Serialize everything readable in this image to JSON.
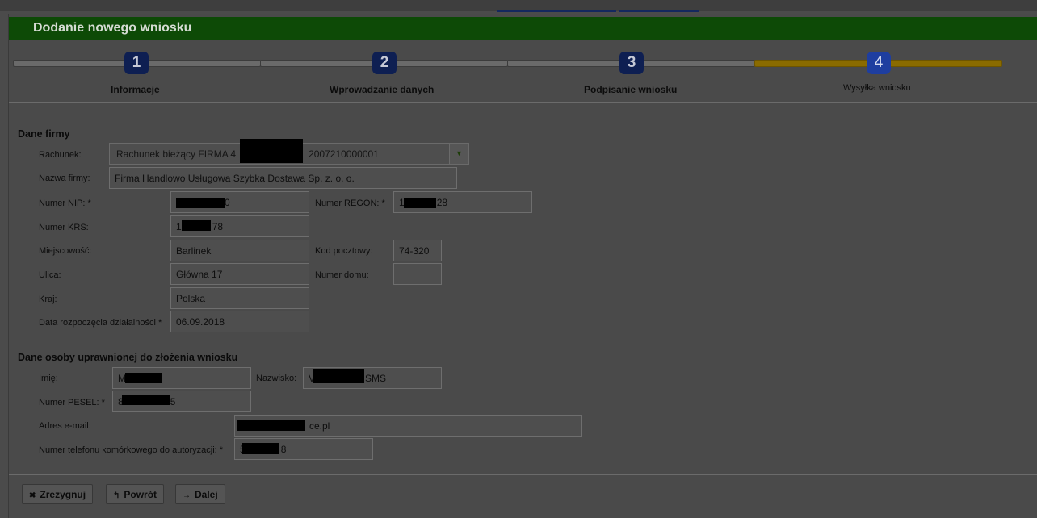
{
  "page": {
    "title": "Dodanie nowego wniosku"
  },
  "steps": [
    {
      "number": "1",
      "label": "Informacje"
    },
    {
      "number": "2",
      "label": "Wprowadzanie danych"
    },
    {
      "number": "3",
      "label": "Podpisanie wniosku"
    },
    {
      "number": "4",
      "label": "Wysyłka wniosku",
      "current": true
    }
  ],
  "company": {
    "section_title": "Dane firmy",
    "account_label": "Rachunek:",
    "account_value_prefix": "Rachunek bieżący FIRMA 4",
    "account_value_suffix": "2007210000001",
    "name_label": "Nazwa firmy:",
    "name_value": "Firma Handlowo Usługowa Szybka Dostawa Sp. z. o. o.",
    "nip_label": "Numer NIP: *",
    "nip_value": "0",
    "regon_label": "Numer REGON: *",
    "regon_value_prefix": "1",
    "regon_value_suffix": "28",
    "krs_label": "Numer KRS:",
    "krs_value_prefix": "1",
    "krs_value_suffix": "78",
    "city_label": "Miejscowość:",
    "city_value": "Barlinek",
    "postal_label": "Kod pocztowy:",
    "postal_value": "74-320",
    "street_label": "Ulica:",
    "street_value": "Główna 17",
    "house_label": "Numer domu:",
    "house_value": "",
    "country_label": "Kraj:",
    "country_value": "Polska",
    "start_label": "Data rozpoczęcia działalności *",
    "start_value": "06.09.2018"
  },
  "person": {
    "section_title": "Dane osoby uprawnionej do złożenia wniosku",
    "first_label": "Imię:",
    "first_value": "M",
    "last_label": "Nazwisko:",
    "last_value_prefix": "V",
    "last_value_suffix": "SMS",
    "pesel_label": "Numer PESEL: *",
    "pesel_value_prefix": "8",
    "pesel_value_suffix": "5",
    "email_label": "Adres e-mail:",
    "email_value": "ce.pl",
    "phone_label": "Numer telefonu komórkowego do autoryzacji: *",
    "phone_value_prefix": "5",
    "phone_value_suffix": "8"
  },
  "buttons": {
    "cancel": "Zrezygnuj",
    "back": "Powrót",
    "next": "Dalej"
  },
  "icons": {
    "cancel": "close-icon",
    "back": "undo-arrow-icon",
    "next": "arrow-right-icon",
    "select": "dropdown-arrow-icon"
  },
  "colors": {
    "title_bar": "#0d4a06",
    "step_badge": "#0e1f52",
    "step_active_bar": "#8a6b00"
  }
}
